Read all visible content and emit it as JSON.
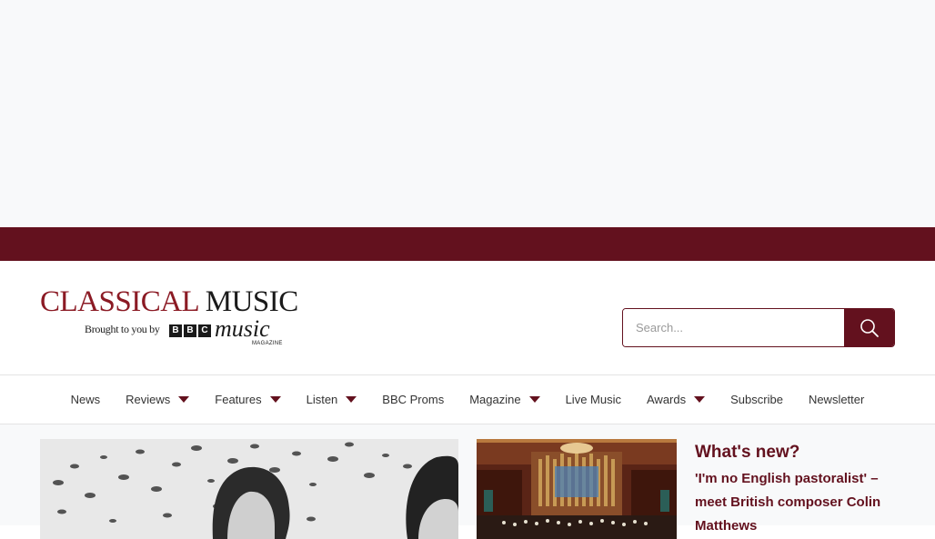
{
  "logo": {
    "word1": "CLASSICAL",
    "word2": "MUSIC",
    "tagline": "Brought to you by",
    "bbc": [
      "B",
      "B",
      "C"
    ],
    "music": "music",
    "magazine": "MAGAZINE"
  },
  "search": {
    "placeholder": "Search...",
    "icon": "search-icon"
  },
  "nav": {
    "items": [
      {
        "label": "News",
        "dropdown": false
      },
      {
        "label": "Reviews",
        "dropdown": true
      },
      {
        "label": "Features",
        "dropdown": true
      },
      {
        "label": "Listen",
        "dropdown": true
      },
      {
        "label": "BBC Proms",
        "dropdown": false
      },
      {
        "label": "Magazine",
        "dropdown": true
      },
      {
        "label": "Live Music",
        "dropdown": false
      },
      {
        "label": "Awards",
        "dropdown": true
      },
      {
        "label": "Subscribe",
        "dropdown": false
      },
      {
        "label": "Newsletter",
        "dropdown": false
      }
    ]
  },
  "whats_new": {
    "title": "What's new?",
    "headline": "'I'm no English pastoralist' – meet British composer Colin Matthews"
  },
  "colors": {
    "brand": "#63111e",
    "logo_red": "#8b1a24",
    "text": "#333333",
    "background": "#f8f9fa"
  }
}
